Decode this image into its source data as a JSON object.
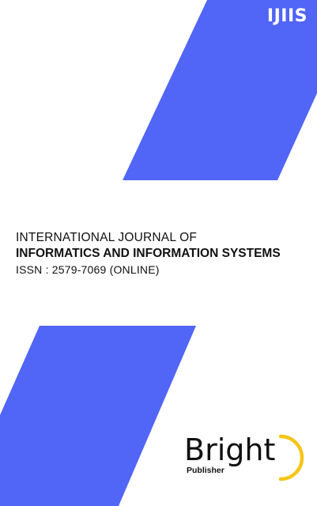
{
  "cover": {
    "journal_abbr": "IJIIS",
    "title_line1": "INTERNATIONAL JOURNAL OF",
    "title_line2": "INFORMATICS AND INFORMATION SYSTEMS",
    "issn": "ISSN : 2579-7069 (ONLINE)",
    "accent_color": "#5165f6",
    "publisher_logo": {
      "brand": "Bright",
      "tagline": "Publisher",
      "arc_color": "#f5c518"
    }
  }
}
